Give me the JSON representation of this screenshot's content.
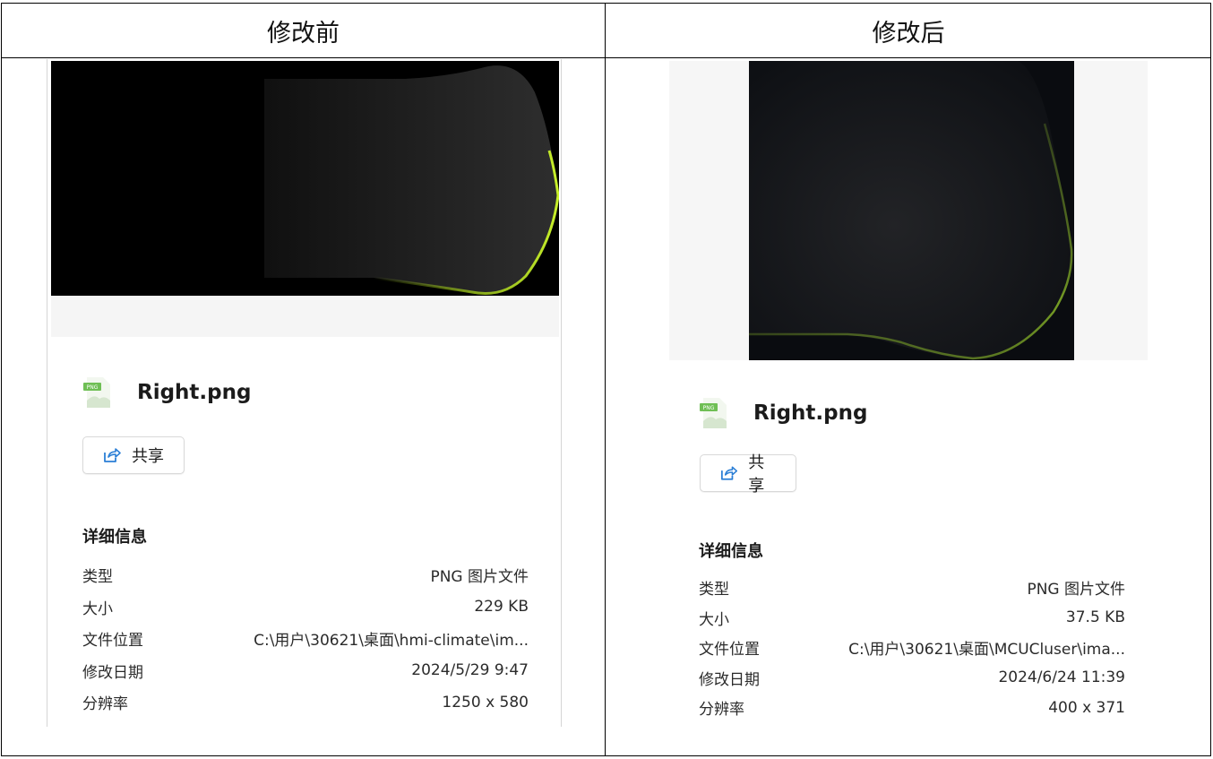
{
  "headers": {
    "before": "修改前",
    "after": "修改后"
  },
  "colors": {
    "accent_green": "#b6e61e",
    "share_blue": "#2b7fd6",
    "png_badge": "#6fbf55"
  },
  "panels": [
    {
      "file_name": "Right.png",
      "file_icon": "png-file-icon",
      "share_label": "共享",
      "details_title": "详细信息",
      "details": [
        {
          "key": "类型",
          "value": "PNG 图片文件"
        },
        {
          "key": "大小",
          "value": "229 KB"
        },
        {
          "key": "文件位置",
          "value": "C:\\用户\\30621\\桌面\\hmi-climate\\im..."
        },
        {
          "key": "修改日期",
          "value": "2024/5/29 9:47"
        },
        {
          "key": "分辨率",
          "value": "1250 x 580"
        }
      ]
    },
    {
      "file_name": "Right.png",
      "file_icon": "png-file-icon",
      "share_label": "共享",
      "details_title": "详细信息",
      "details": [
        {
          "key": "类型",
          "value": "PNG 图片文件"
        },
        {
          "key": "大小",
          "value": "37.5 KB"
        },
        {
          "key": "文件位置",
          "value": "C:\\用户\\30621\\桌面\\MCUCluser\\ima..."
        },
        {
          "key": "修改日期",
          "value": "2024/6/24 11:39"
        },
        {
          "key": "分辨率",
          "value": "400 x 371"
        }
      ]
    }
  ]
}
